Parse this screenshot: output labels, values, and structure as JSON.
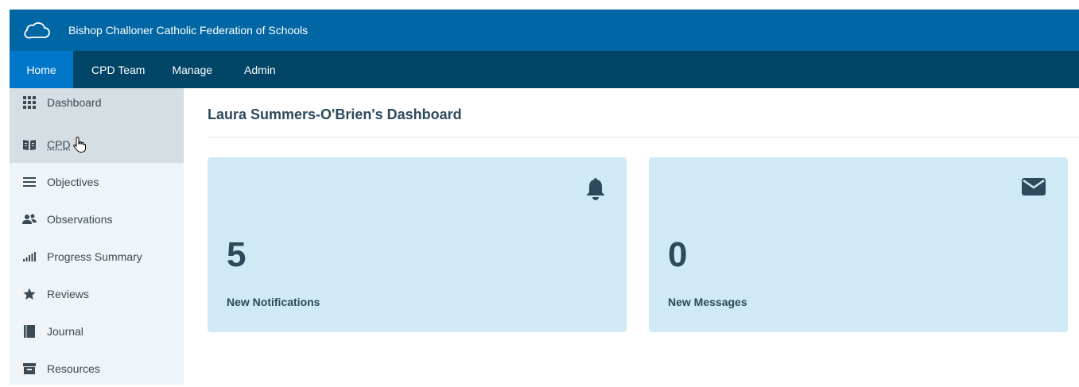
{
  "header": {
    "org_name": "Bishop Challoner Catholic Federation of Schools",
    "logo_icon": "cloud-outline-icon",
    "bg_color": "#0066a4"
  },
  "nav": {
    "bg_color": "#004466",
    "active_color": "#0077c8",
    "items": [
      {
        "label": "Home",
        "active": true
      },
      {
        "label": "CPD Team"
      },
      {
        "label": "Manage"
      },
      {
        "label": "Admin"
      }
    ]
  },
  "sidebar": {
    "items": [
      {
        "label": "Dashboard",
        "icon": "grid-icon",
        "active": true
      },
      {
        "label": "CPD",
        "icon": "book-open-icon",
        "active": true
      },
      {
        "label": "Objectives",
        "icon": "list-icon"
      },
      {
        "label": "Observations",
        "icon": "users-icon"
      },
      {
        "label": "Progress Summary",
        "icon": "bar-signal-icon"
      },
      {
        "label": "Reviews",
        "icon": "star-icon"
      },
      {
        "label": "Journal",
        "icon": "book-icon"
      },
      {
        "label": "Resources",
        "icon": "archive-icon"
      }
    ]
  },
  "main": {
    "title": "Laura Summers-O'Brien's Dashboard",
    "cards": [
      {
        "count": "5",
        "caption": "New Notifications",
        "icon": "bell-icon"
      },
      {
        "count": "0",
        "caption": "New Messages",
        "icon": "envelope-icon"
      }
    ],
    "card_color": "#cfe9f6",
    "text_color": "#2c4a5c"
  }
}
